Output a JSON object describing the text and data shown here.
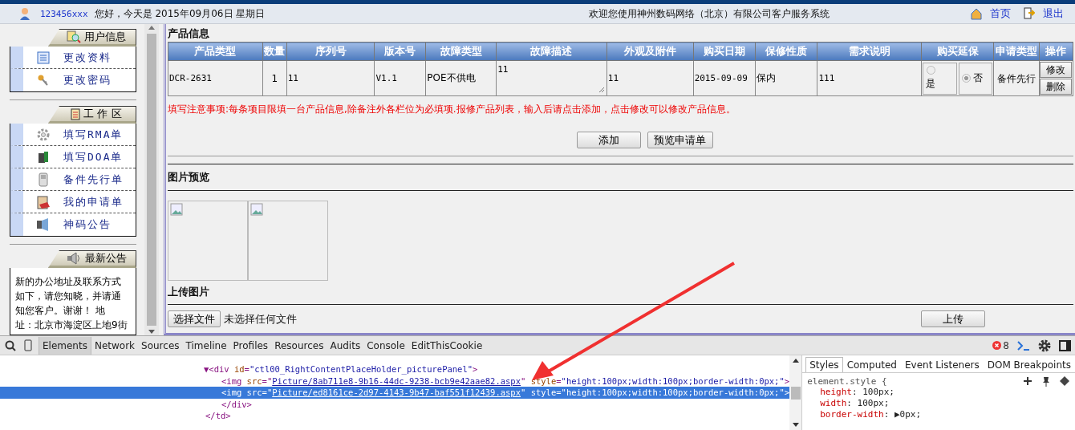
{
  "header": {
    "user": "123456xxx",
    "greeting": "您好，今天是 2015年09月06日 星期日",
    "welcome": "欢迎您使用神州数码网络（北京）有限公司客户服务系统",
    "links": [
      {
        "kind": "home",
        "label": "首页"
      },
      {
        "kind": "exit",
        "label": "退出"
      }
    ]
  },
  "sidebar": {
    "sections": [
      {
        "kind": "user",
        "title": "用户信息",
        "items": [
          {
            "kind": "list",
            "label": "更改资料"
          },
          {
            "kind": "keys",
            "label": "更改密码"
          }
        ]
      },
      {
        "kind": "work",
        "title": "工 作 区",
        "items": [
          {
            "kind": "gear",
            "label": "填写RMA单"
          },
          {
            "kind": "server",
            "label": "填写DOA单"
          },
          {
            "kind": "phone",
            "label": "备件先行单"
          },
          {
            "kind": "clipboard",
            "label": "我的申请单"
          },
          {
            "kind": "speaker",
            "label": "神码公告"
          }
        ]
      },
      {
        "kind": "news",
        "title": "最新公告",
        "lines": [
          "新的办公地址及联系方式",
          "如下，请您知晓，并请通",
          "知您客户。谢谢！  地",
          "址：北京市海淀区上地9街"
        ]
      }
    ]
  },
  "product": {
    "title": "产品信息",
    "columns": [
      "产品类型",
      "数量",
      "序列号",
      "版本号",
      "故障类型",
      "故障描述",
      "外观及附件",
      "购买日期",
      "保修性质",
      "需求说明",
      "购买延保",
      "申请类型",
      "操作"
    ],
    "rows": [
      {
        "type": "DCR-2631",
        "quantity": "1",
        "serial": "11",
        "version": "V1.1",
        "fault_type": "POE不供电",
        "fault_desc": "11",
        "appearance": "11",
        "purchase_date": "2015-09-09",
        "warranty": "保内",
        "requirement": "111",
        "extended": [
          {
            "label": "是",
            "selected": false
          },
          {
            "label": "否",
            "selected": true
          }
        ],
        "apply_type": "备件先行",
        "actions": [
          "修改",
          "删除"
        ]
      }
    ],
    "notice": "填写注意事项:每条项目限填一台产品信息,除备注外各栏位为必填项.报修产品列表，输入后请点击添加，点击修改可以修改产品信息。",
    "buttons": [
      "添加",
      "预览申请单"
    ]
  },
  "preview": {
    "title": "图片预览",
    "images": [
      {
        "kind": "broken"
      },
      {
        "kind": "broken"
      }
    ]
  },
  "upload": {
    "title": "上传图片",
    "choose": "选择文件",
    "status": "未选择任何文件",
    "button": "上传"
  },
  "devtools": {
    "tabs": [
      {
        "label": "Elements",
        "selected": true
      },
      {
        "label": "Network",
        "selected": false
      },
      {
        "label": "Sources",
        "selected": false
      },
      {
        "label": "Timeline",
        "selected": false
      },
      {
        "label": "Profiles",
        "selected": false
      },
      {
        "label": "Resources",
        "selected": false
      },
      {
        "label": "Audits",
        "selected": false
      },
      {
        "label": "Console",
        "selected": false
      },
      {
        "label": "EditThisCookie",
        "selected": false
      }
    ],
    "errors": "8",
    "tree": [
      {
        "kind": "open",
        "selected": false,
        "parts": [
          {
            "kind": "tag",
            "text": "▼<div "
          },
          {
            "kind": "attr",
            "text": "id"
          },
          {
            "kind": "tag",
            "text": "="
          },
          {
            "kind": "value",
            "text": "\"ctl00_RightContentPlaceHolder_picturePanel\""
          },
          {
            "kind": "tag",
            "text": ">"
          }
        ]
      },
      {
        "kind": "child",
        "selected": false,
        "parts": [
          {
            "kind": "tag",
            "text": "<img "
          },
          {
            "kind": "attr",
            "text": "src"
          },
          {
            "kind": "tag",
            "text": "=\""
          },
          {
            "kind": "link",
            "text": "Picture/8ab711e8-9b16-44dc-9238-bcb9e42aae82.aspx"
          },
          {
            "kind": "tag",
            "text": "\" "
          },
          {
            "kind": "attr",
            "text": "style"
          },
          {
            "kind": "tag",
            "text": "="
          },
          {
            "kind": "value",
            "text": "\"height:100px;width:100px;border-width:0px;\""
          },
          {
            "kind": "tag",
            "text": ">"
          }
        ]
      },
      {
        "kind": "child",
        "selected": true,
        "parts": [
          {
            "kind": "tag",
            "text": "<img "
          },
          {
            "kind": "attr",
            "text": "src"
          },
          {
            "kind": "tag",
            "text": "=\""
          },
          {
            "kind": "link",
            "text": "Picture/ed8161ce-2d97-4143-9b47-baf551f12439.aspx"
          },
          {
            "kind": "tag",
            "text": "\" "
          },
          {
            "kind": "attr",
            "text": "style"
          },
          {
            "kind": "tag",
            "text": "="
          },
          {
            "kind": "value",
            "text": "\"height:100px;width:100px;border-width:0px;\""
          },
          {
            "kind": "tag",
            "text": ">"
          }
        ]
      },
      {
        "kind": "child",
        "selected": false,
        "parts": [
          {
            "kind": "tag",
            "text": "</div>"
          }
        ]
      },
      {
        "kind": "close",
        "selected": false,
        "parts": [
          {
            "kind": "tag",
            "text": "</td>"
          }
        ]
      }
    ],
    "styles_tabs": [
      {
        "label": "Styles",
        "selected": true
      },
      {
        "label": "Computed",
        "selected": false
      },
      {
        "label": "Event Listeners",
        "selected": false
      },
      {
        "label": "DOM Breakpoints",
        "selected": false
      }
    ],
    "rule": {
      "selector": "element.style {",
      "props": [
        {
          "name": "height",
          "sep": ":",
          "value": "100px;"
        },
        {
          "name": "width",
          "sep": ":",
          "value": "100px;"
        },
        {
          "name": "border-width",
          "sep": ":",
          "value": "▶0px;"
        }
      ]
    }
  }
}
